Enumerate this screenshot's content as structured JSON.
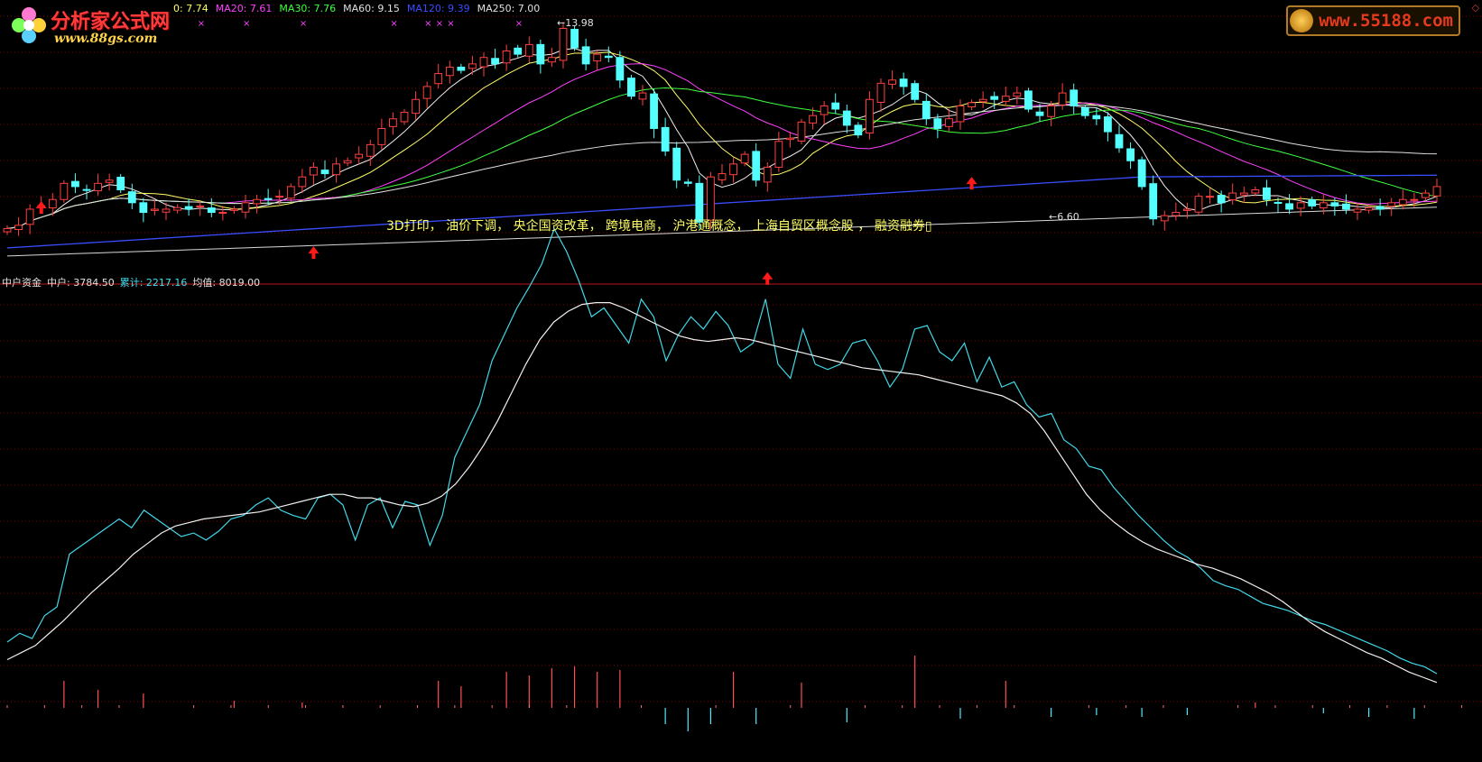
{
  "logos": {
    "left_brand": "分析家公式网",
    "left_url": "www.88gs.com",
    "right_url": "www.55188.com"
  },
  "ma_legend": [
    {
      "text": "0: 7.74",
      "color": "#ffff66"
    },
    {
      "text": "MA20: 7.61",
      "color": "#ff40ff"
    },
    {
      "text": "MA30: 7.76",
      "color": "#40ff40"
    },
    {
      "text": "MA60: 9.15",
      "color": "#e0e0e0"
    },
    {
      "text": "MA120: 9.39",
      "color": "#3a4dff"
    },
    {
      "text": "MA250: 7.00",
      "color": "#e0e0e0"
    }
  ],
  "indicator_legend": [
    {
      "text": "中户资金",
      "color": "#e0e0e0"
    },
    {
      "text": "中户: 3784.50",
      "color": "#e0e0e0"
    },
    {
      "text": "累计: 2217.16",
      "color": "#40e0f0"
    },
    {
      "text": "均值: 8019.00",
      "color": "#e0e0e0"
    }
  ],
  "concepts_text": "3D打印， 油价下调， 央企国资改革， 跨境电商， 沪港通概念， 上海自贸区概念股 ， 融资融券▯",
  "price_high_label": "13.98",
  "price_low_label": "6.60",
  "colors": {
    "up": "#ff4040",
    "down": "#54ffff",
    "grid": "#8b0000",
    "divider": "#c01818",
    "signal_arrow": "#ff1a1a",
    "cross_marker": "#ff40ff"
  },
  "chart_data": [
    {
      "type": "candlestick",
      "title": "",
      "x": [
        0,
        1,
        2,
        3,
        4,
        5,
        6,
        7,
        8,
        9,
        10,
        11,
        12,
        13,
        14,
        15,
        16,
        17,
        18,
        19,
        20,
        21,
        22,
        23,
        24,
        25,
        26,
        27,
        28,
        29,
        30,
        31,
        32,
        33,
        34,
        35,
        36,
        37,
        38,
        39,
        40,
        41,
        42,
        43,
        44,
        45,
        46,
        47,
        48,
        49,
        50,
        51,
        52,
        53,
        54,
        55,
        56,
        57,
        58,
        59,
        60,
        61,
        62,
        63,
        64,
        65,
        66,
        67,
        68,
        69,
        70,
        71,
        72,
        73,
        74,
        75,
        76,
        77,
        78,
        79,
        80,
        81,
        82,
        83,
        84,
        85,
        86,
        87,
        88,
        89,
        90,
        91,
        92,
        93,
        94,
        95,
        96,
        97,
        98,
        99,
        100,
        101,
        102,
        103,
        104,
        105,
        106,
        107,
        108,
        109,
        110,
        111,
        112,
        113,
        114,
        115,
        116,
        117,
        118,
        119,
        120,
        121,
        122,
        123,
        124,
        125,
        126
      ],
      "close": [
        7.5,
        7.6,
        8.1,
        8.2,
        8.4,
        8.9,
        8.8,
        8.7,
        8.9,
        9.0,
        8.7,
        8.3,
        8.0,
        8.1,
        8.1,
        8.15,
        8.1,
        8.2,
        8.0,
        8.0,
        8.1,
        8.3,
        8.4,
        8.4,
        8.5,
        8.8,
        9.1,
        9.4,
        9.2,
        9.5,
        9.6,
        9.8,
        10.1,
        10.6,
        10.9,
        11.1,
        11.5,
        11.9,
        12.3,
        12.5,
        12.4,
        12.6,
        12.8,
        12.6,
        13.0,
        12.9,
        13.2,
        12.6,
        12.8,
        13.7,
        13.1,
        12.6,
        12.9,
        12.8,
        12.1,
        11.6,
        11.7,
        10.6,
        9.9,
        9.0,
        8.9,
        7.7,
        9.1,
        9.2,
        9.5,
        9.8,
        9.0,
        9.4,
        10.2,
        10.3,
        10.8,
        11.0,
        11.3,
        11.2,
        10.7,
        10.4,
        11.5,
        12.0,
        12.1,
        11.9,
        11.5,
        10.9,
        10.6,
        10.9,
        11.3,
        11.4,
        11.5,
        11.5,
        11.6,
        11.7,
        11.2,
        11.0,
        11.3,
        11.7,
        11.3,
        11.0,
        10.9,
        10.5,
        10.0,
        9.6,
        8.8,
        7.8,
        7.9,
        8.0,
        8.1,
        8.5,
        8.5,
        8.3,
        8.6,
        8.6,
        8.7,
        8.4,
        8.3,
        8.1,
        8.3,
        8.2,
        8.3,
        8.2,
        8.1,
        8.1,
        8.15,
        8.1,
        8.3,
        8.4,
        8.4,
        8.6,
        8.8
      ],
      "high_marker": 13.98,
      "low_marker": 6.6,
      "ma_series": [
        "MA5",
        "MA20",
        "MA30",
        "MA60",
        "MA120",
        "MA250"
      ],
      "ylim": [
        6.2,
        14.3
      ]
    },
    {
      "type": "line",
      "title": "中户资金",
      "series": [
        {
          "name": "中户",
          "values": [
            40,
            45,
            42,
            55,
            60,
            90,
            95,
            100,
            105,
            110,
            105,
            115,
            110,
            105,
            100,
            102,
            98,
            103,
            110,
            112,
            118,
            122,
            115,
            112,
            110,
            122,
            124,
            118,
            98,
            118,
            122,
            105,
            120,
            118,
            95,
            112,
            145,
            160,
            175,
            200,
            215,
            230,
            242,
            255,
            275,
            262,
            245,
            225,
            230,
            220,
            210,
            235,
            225,
            200,
            215,
            225,
            218,
            228,
            220,
            205,
            210,
            235,
            198,
            190,
            218,
            198,
            195,
            198,
            210,
            212,
            200,
            185,
            195,
            218,
            220,
            205,
            200,
            210,
            188,
            202,
            185,
            188,
            175,
            168,
            170,
            155,
            150,
            140,
            138,
            128,
            120,
            112,
            105,
            98,
            92,
            88,
            82,
            75,
            72,
            70,
            66,
            62,
            60,
            58,
            55,
            52,
            50,
            47,
            44,
            41,
            38,
            35,
            31,
            28,
            26,
            22
          ]
        },
        {
          "name": "累计",
          "values": [
            30,
            34,
            38,
            45,
            52,
            60,
            68,
            75,
            82,
            90,
            96,
            102,
            106,
            108,
            110,
            111,
            112,
            113,
            114,
            116,
            118,
            120,
            122,
            124,
            124,
            122,
            122,
            120,
            118,
            117,
            119,
            123,
            130,
            140,
            152,
            166,
            182,
            198,
            212,
            222,
            228,
            232,
            233,
            233,
            230,
            226,
            222,
            218,
            214,
            212,
            211,
            212,
            213,
            212,
            210,
            208,
            206,
            204,
            202,
            200,
            198,
            196,
            195,
            194,
            193,
            192,
            190,
            188,
            186,
            184,
            182,
            180,
            176,
            170,
            160,
            148,
            136,
            124,
            115,
            108,
            102,
            97,
            93,
            90,
            87,
            84,
            82,
            79,
            76,
            72,
            68,
            63,
            57,
            51,
            46,
            42,
            38,
            34,
            31,
            27,
            23,
            20,
            17
          ]
        },
        {
          "name": "均值",
          "values": [
            10,
            12,
            14,
            16,
            18,
            20,
            22,
            24,
            26,
            28,
            30,
            32,
            34,
            36,
            38,
            40,
            42,
            44,
            46,
            48,
            50,
            52,
            54,
            56,
            58,
            60,
            62,
            64,
            66,
            68,
            70,
            72,
            74,
            76,
            78,
            80,
            82,
            84,
            86,
            88,
            90,
            92,
            94,
            96,
            98,
            100,
            102,
            104,
            106,
            108,
            110,
            112,
            114,
            116,
            118,
            120,
            122,
            124,
            126,
            128,
            130,
            132,
            134,
            136,
            138,
            140,
            142,
            144,
            146,
            148,
            150,
            152,
            154,
            156,
            158,
            160,
            162,
            164,
            166,
            168,
            170,
            172,
            174,
            176,
            178,
            180,
            182,
            184,
            186,
            188,
            190,
            192,
            194,
            196,
            198,
            200,
            202,
            204,
            206,
            208,
            210,
            212,
            214,
            216,
            218,
            220,
            222,
            224,
            226,
            228,
            230,
            232,
            234,
            236,
            238,
            240
          ]
        }
      ],
      "histogram": [
        {
          "x": 5,
          "v": 30
        },
        {
          "x": 8,
          "v": 20
        },
        {
          "x": 12,
          "v": 16
        },
        {
          "x": 20,
          "v": 8
        },
        {
          "x": 26,
          "v": 6
        },
        {
          "x": 38,
          "v": 30
        },
        {
          "x": 40,
          "v": 24
        },
        {
          "x": 44,
          "v": 40
        },
        {
          "x": 46,
          "v": 36
        },
        {
          "x": 48,
          "v": 44
        },
        {
          "x": 50,
          "v": 46
        },
        {
          "x": 52,
          "v": 40
        },
        {
          "x": 54,
          "v": 42
        },
        {
          "x": 58,
          "v": -18
        },
        {
          "x": 60,
          "v": -26
        },
        {
          "x": 62,
          "v": -18
        },
        {
          "x": 64,
          "v": 40
        },
        {
          "x": 66,
          "v": -18
        },
        {
          "x": 70,
          "v": 28
        },
        {
          "x": 74,
          "v": -16
        },
        {
          "x": 80,
          "v": 58
        },
        {
          "x": 84,
          "v": -12
        },
        {
          "x": 88,
          "v": 30
        },
        {
          "x": 92,
          "v": -10
        },
        {
          "x": 96,
          "v": -8
        },
        {
          "x": 100,
          "v": -10
        },
        {
          "x": 104,
          "v": -8
        },
        {
          "x": 110,
          "v": 6
        },
        {
          "x": 116,
          "v": -6
        },
        {
          "x": 120,
          "v": -10
        },
        {
          "x": 124,
          "v": -12
        }
      ]
    }
  ]
}
